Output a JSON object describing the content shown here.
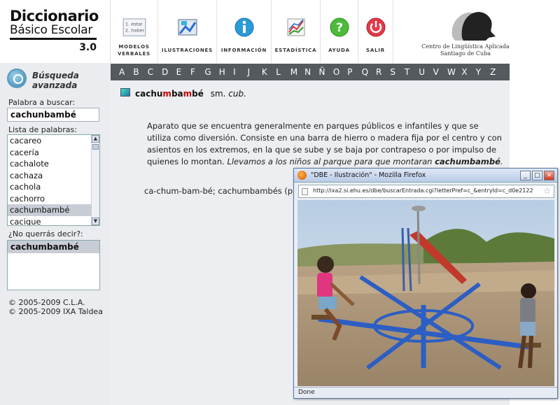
{
  "app": {
    "logo_line1": "Diccionario",
    "logo_line2": "Básico Escolar",
    "logo_version": "3.0"
  },
  "toolbar": {
    "items": [
      {
        "label": "MODELOS VERBALES",
        "icon": "verb-models-icon",
        "icon_text": "1. estar\n2. haber"
      },
      {
        "label": "ILUSTRACIONES",
        "icon": "illustrations-icon"
      },
      {
        "label": "INFORMACIÓN",
        "icon": "info-icon"
      },
      {
        "label": "ESTADÍSTICA",
        "icon": "statistics-icon"
      },
      {
        "label": "AYUDA",
        "icon": "help-icon"
      },
      {
        "label": "SALIR",
        "icon": "power-icon"
      }
    ],
    "icon_text_1": "1. estar",
    "icon_text_2": "2. haber"
  },
  "institution": {
    "line1": "Centro de Lingüística Aplicada",
    "line2": "Santiago de Cuba"
  },
  "alphabet": [
    "A",
    "B",
    "C",
    "D",
    "E",
    "F",
    "G",
    "H",
    "I",
    "J",
    "K",
    "L",
    "M",
    "N",
    "Ñ",
    "O",
    "P",
    "Q",
    "R",
    "S",
    "T",
    "U",
    "V",
    "W",
    "X",
    "Y",
    "Z"
  ],
  "sidebar": {
    "advanced_search": "Búsqueda avanzada",
    "advanced_line1": "Búsqueda",
    "advanced_line2": "avanzada",
    "search_label": "Palabra a buscar:",
    "search_value": "cachunbambé",
    "list_label": "Lista de palabras:",
    "words": [
      "cacareo",
      "cacería",
      "cachalote",
      "cachaza",
      "cachola",
      "cachorro",
      "cachumbambé",
      "cacique"
    ],
    "selected_word_index": 6,
    "suggest_label": "¿No querrás decir?:",
    "suggestion": "cachumbambé",
    "copyright1": "© 2005-2009 C.L.A.",
    "copyright2": "© 2005-2009 IXA Taldea"
  },
  "entry": {
    "head_pre": "cachu",
    "head_hl1": "m",
    "head_mid": "ba",
    "head_hl2": "m",
    "head_post": "bé",
    "category": "sm.",
    "region": "cub.",
    "definition": "Aparato que se encuentra generalmente en parques públicos e infantiles y que se utiliza como diversión. Consiste en una barra de hierro o madera fija por el centro y con asientos en los extremos, en la que se sube y se baja por contrapeso o por impulso de quienes lo montan.",
    "example_pre": "Llevamos a los niños al parque para que montaran ",
    "example_word": "cachumbambé",
    "example_post": ".",
    "syllabification": "ca-chum-bam-bé; cachumbambés (pl.)"
  },
  "popup": {
    "title": "\"DBE - Ilustración\" - Mozilla Firefox",
    "url": "http://ixa2.si.ehu.es/dbe/buscarEntrada.cgi?letterPref=c_&entryId=c_d0e2122",
    "status": "Done",
    "btn_min": "_",
    "btn_max": "□",
    "btn_close": "✕"
  }
}
